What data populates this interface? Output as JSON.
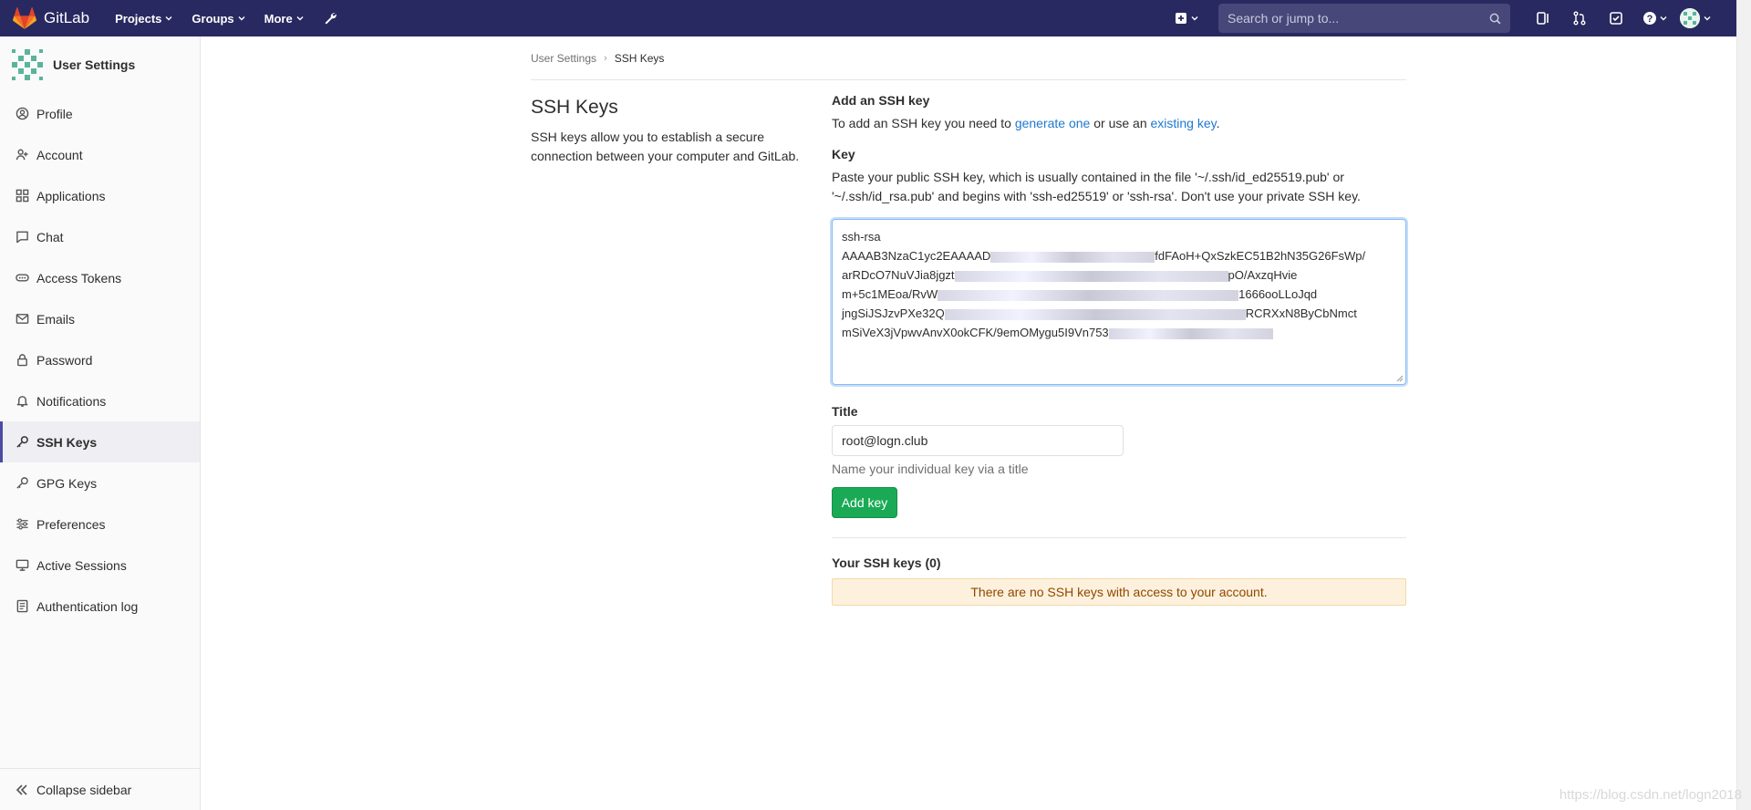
{
  "navbar": {
    "brand": "GitLab",
    "menu": [
      {
        "label": "Projects"
      },
      {
        "label": "Groups"
      },
      {
        "label": "More"
      }
    ],
    "search_placeholder": "Search or jump to...",
    "icons": [
      "plus-icon",
      "sidebar-toggle-icon",
      "merge-request-icon",
      "todo-icon",
      "help-icon",
      "avatar"
    ]
  },
  "sidebar": {
    "title": "User Settings",
    "items": [
      {
        "label": "Profile",
        "icon": "profile-icon"
      },
      {
        "label": "Account",
        "icon": "account-icon"
      },
      {
        "label": "Applications",
        "icon": "applications-icon"
      },
      {
        "label": "Chat",
        "icon": "chat-icon"
      },
      {
        "label": "Access Tokens",
        "icon": "access-tokens-icon"
      },
      {
        "label": "Emails",
        "icon": "emails-icon"
      },
      {
        "label": "Password",
        "icon": "lock-icon"
      },
      {
        "label": "Notifications",
        "icon": "bell-icon"
      },
      {
        "label": "SSH Keys",
        "icon": "key-icon"
      },
      {
        "label": "GPG Keys",
        "icon": "key-icon"
      },
      {
        "label": "Preferences",
        "icon": "preferences-icon"
      },
      {
        "label": "Active Sessions",
        "icon": "sessions-icon"
      },
      {
        "label": "Authentication log",
        "icon": "log-icon"
      }
    ],
    "active": "SSH Keys",
    "collapse_label": "Collapse sidebar"
  },
  "breadcrumb": {
    "parent": "User Settings",
    "current": "SSH Keys"
  },
  "page": {
    "title": "SSH Keys",
    "description": "SSH keys allow you to establish a secure connection between your computer and GitLab."
  },
  "add_key": {
    "heading": "Add an SSH key",
    "intro_prefix": "To add an SSH key you need to ",
    "intro_link1": "generate one",
    "intro_middle": " or use an ",
    "intro_link2": "existing key",
    "intro_suffix": ".",
    "key_label": "Key",
    "key_help": "Paste your public SSH key, which is usually contained in the file '~/.ssh/id_ed25519.pub' or '~/.ssh/id_rsa.pub' and begins with 'ssh-ed25519' or 'ssh-rsa'. Don't use your private SSH key.",
    "key_lines": [
      "ssh-rsa",
      "AAAAB3NzaC1yc2EAAAAD",
      "arRDcO7NuVJia8jgzt",
      "m+5c1MEoa/RvW",
      "jngSiJSJzvPXe32Q",
      "mSiVeX3jVpwvAnvX0okCFK/9e"
    ],
    "key_line_tails": [
      "",
      "fdFAoH+QxSzkEC51B2hN35G26FsWp/",
      "pO/AxzqHvie",
      "1666ooLLoJqd",
      "RCRXxN8ByCbNmct",
      "mOMygu5I9Vn753"
    ],
    "title_label": "Title",
    "title_value": "root@logn.club",
    "title_hint": "Name your individual key via a title",
    "submit_label": "Add key"
  },
  "your_keys": {
    "heading": "Your SSH keys (0)",
    "empty_message": "There are no SSH keys with access to your account."
  },
  "watermark": "https://blog.csdn.net/logn2018",
  "colors": {
    "navbar": "#292961",
    "accent": "#1f78d1",
    "success": "#1aaa55",
    "warning_bg": "#fdf1dd"
  }
}
